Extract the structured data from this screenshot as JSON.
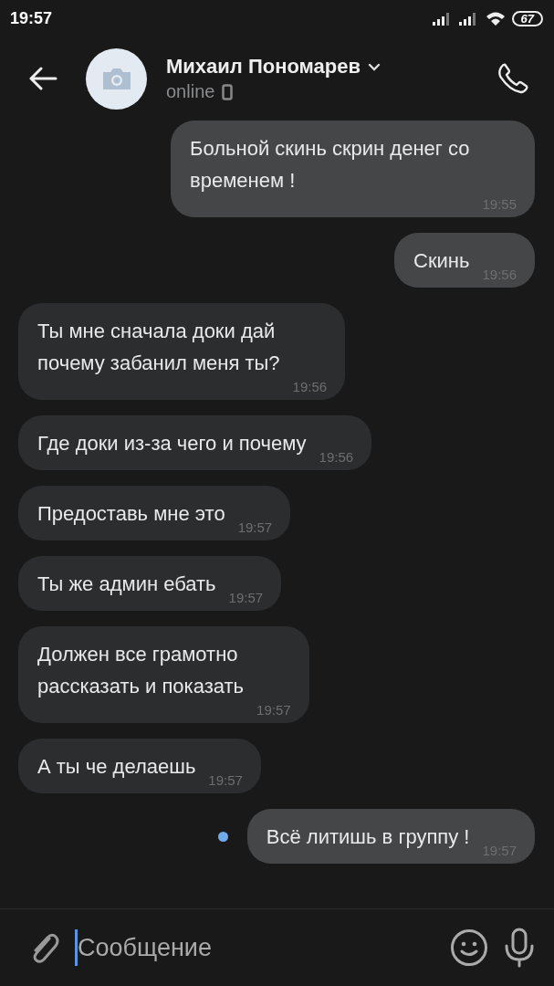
{
  "status_bar": {
    "time": "19:57",
    "battery": "67"
  },
  "header": {
    "name": "Михаил Пономарев",
    "status": "online"
  },
  "messages": [
    {
      "kind": "outgoing",
      "text": "Больной скинь скрин денег со\nвременем !",
      "time": "19:55",
      "unread": false
    },
    {
      "kind": "outgoing",
      "text": "Скинь",
      "time": "19:56",
      "unread": false
    },
    {
      "kind": "incoming",
      "text": "Ты мне сначала доки дай\nпочему забанил меня ты?",
      "time": "19:56",
      "unread": false
    },
    {
      "kind": "incoming",
      "text": "Где доки из-за чего и почему",
      "time": "19:56",
      "unread": false
    },
    {
      "kind": "incoming",
      "text": "Предоставь мне это",
      "time": "19:57",
      "unread": false
    },
    {
      "kind": "incoming",
      "text": "Ты же админ ебать",
      "time": "19:57",
      "unread": false
    },
    {
      "kind": "incoming",
      "text": "Должен все грамотно\nрассказать и показать",
      "time": "19:57",
      "unread": false
    },
    {
      "kind": "incoming",
      "text": "А ты че делаешь",
      "time": "19:57",
      "unread": false
    },
    {
      "kind": "outgoing",
      "text": "Всё литишь в группу !",
      "time": "19:57",
      "unread": true
    }
  ],
  "composer": {
    "placeholder": "Сообщение"
  }
}
